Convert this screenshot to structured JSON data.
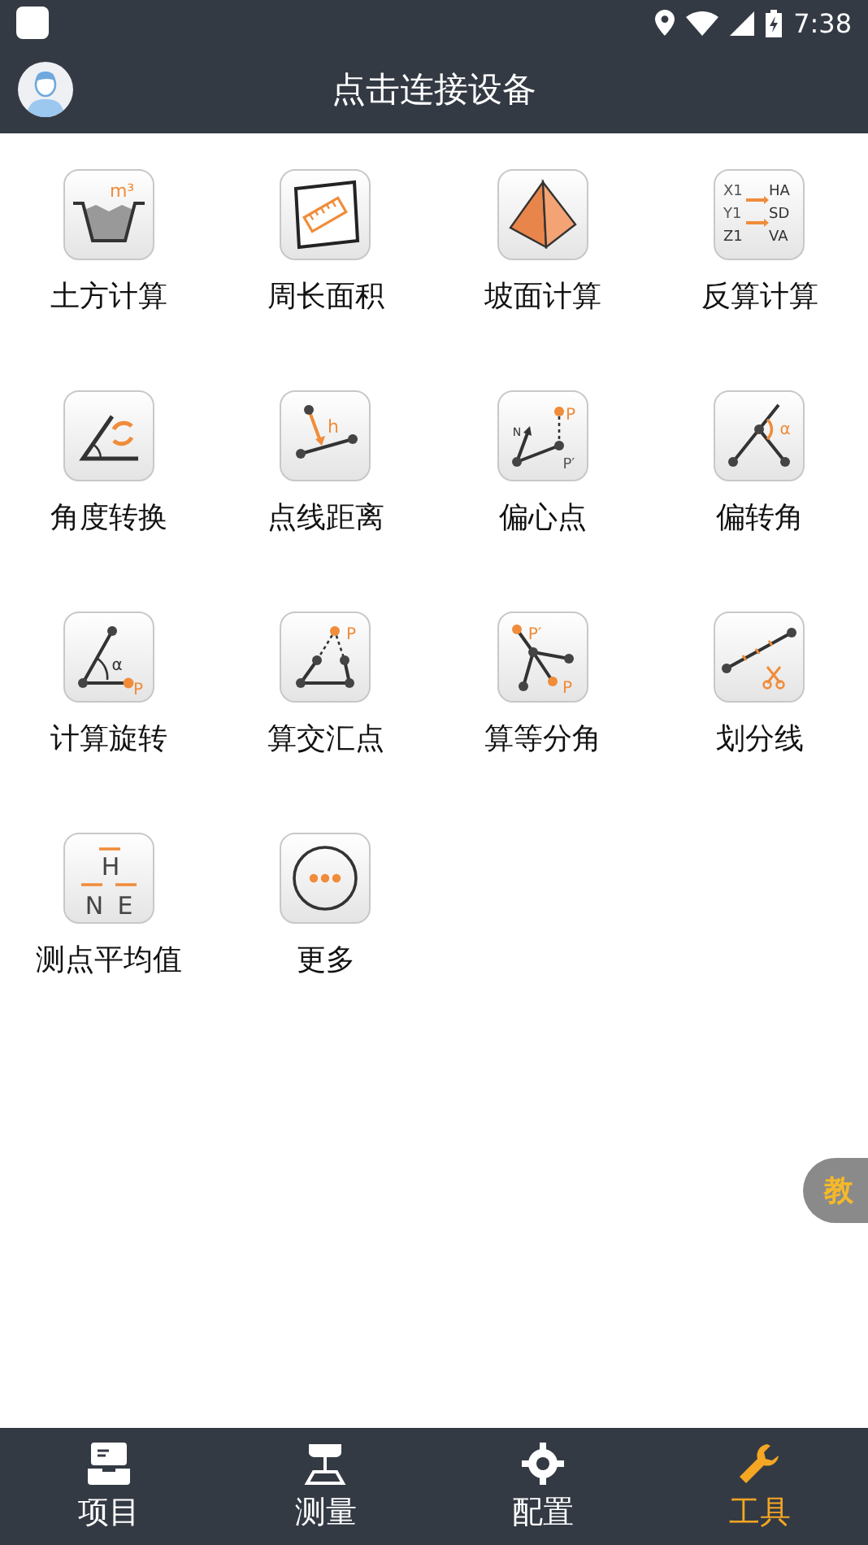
{
  "status_bar": {
    "time": "7:38"
  },
  "header": {
    "title": "点击连接设备"
  },
  "tools": [
    {
      "label": "土方计算",
      "kind": "earthwork",
      "glyphs": [
        "m³"
      ]
    },
    {
      "label": "周长面积",
      "kind": "perimeter"
    },
    {
      "label": "坡面计算",
      "kind": "slope"
    },
    {
      "label": "反算计算",
      "kind": "inverse",
      "glyphs": [
        "X1",
        "HA",
        "Y1",
        "SD",
        "Z1",
        "VA"
      ]
    },
    {
      "label": "角度转换",
      "kind": "angle"
    },
    {
      "label": "点线距离",
      "kind": "pointline",
      "glyphs": [
        "h"
      ]
    },
    {
      "label": "偏心点",
      "kind": "eccentric",
      "glyphs": [
        "N",
        "P",
        "P′"
      ]
    },
    {
      "label": "偏转角",
      "kind": "deflection",
      "glyphs": [
        "α"
      ]
    },
    {
      "label": "计算旋转",
      "kind": "rotation",
      "glyphs": [
        "α",
        "P"
      ]
    },
    {
      "label": "算交汇点",
      "kind": "intersection",
      "glyphs": [
        "P"
      ]
    },
    {
      "label": "算等分角",
      "kind": "bisect",
      "glyphs": [
        "P′",
        "P"
      ]
    },
    {
      "label": "划分线",
      "kind": "divide"
    },
    {
      "label": "测点平均值",
      "kind": "average",
      "glyphs": [
        "H",
        "N",
        "E"
      ]
    },
    {
      "label": "更多",
      "kind": "more"
    }
  ],
  "side_tab": {
    "label": "教"
  },
  "bottom_nav": [
    {
      "label": "项目",
      "kind": "project",
      "selected": false
    },
    {
      "label": "测量",
      "kind": "survey",
      "selected": false
    },
    {
      "label": "配置",
      "kind": "config",
      "selected": false
    },
    {
      "label": "工具",
      "kind": "tools",
      "selected": true
    }
  ]
}
